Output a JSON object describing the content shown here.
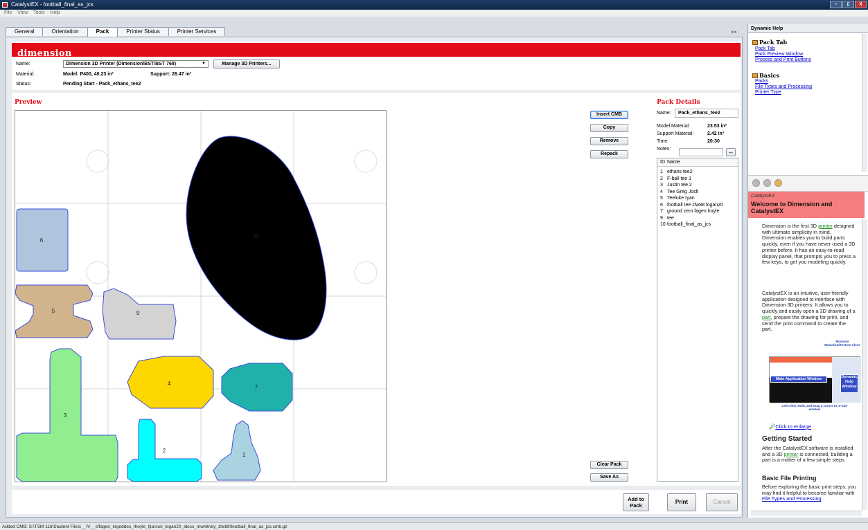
{
  "window": {
    "title": "CatalystEX - football_final_as_jcs",
    "buttons": [
      "–",
      "▯",
      "X"
    ]
  },
  "menu": [
    "File",
    "View",
    "Tools",
    "Help"
  ],
  "tabs": [
    {
      "label": "General",
      "active": false
    },
    {
      "label": "Orientation",
      "active": false
    },
    {
      "label": "Pack",
      "active": true
    },
    {
      "label": "Printer Status",
      "active": false
    },
    {
      "label": "Printer Services",
      "active": false
    }
  ],
  "header": {
    "logo": "dimension",
    "name_label": "Name:",
    "printer_value": "Dimension 3D Printer  (Dimension/BST/BST 768)",
    "manage_button": "Manage 3D Printers...",
    "material_label": "Material:",
    "model_text": "Model: P400, 40.23 in³",
    "support_text": "Support: 26.47 in³",
    "status_label": "Status:",
    "status_value": "Pending Start  -  Pack_ethans_tee2"
  },
  "preview": {
    "title": "Preview",
    "parts": [
      {
        "id": "1",
        "label": "1",
        "color": "#a9d3e0"
      },
      {
        "id": "2",
        "label": "2",
        "color": "#00ffff"
      },
      {
        "id": "3",
        "label": "3",
        "color": "#90ee90"
      },
      {
        "id": "4",
        "label": "4",
        "color": "#ffd700"
      },
      {
        "id": "5",
        "label": "5",
        "color": "#d2b48c"
      },
      {
        "id": "6",
        "label": "6",
        "color": "#b0c4de"
      },
      {
        "id": "7",
        "label": "7",
        "color": "#20b2aa"
      },
      {
        "id": "9",
        "label": "9",
        "color": "#d3d3d3"
      },
      {
        "id": "10",
        "label": "10",
        "color": "#add8e6"
      }
    ]
  },
  "buttons": {
    "insert": "Insert CMB",
    "copy": "Copy",
    "remove": "Remove",
    "repack": "Repack",
    "clear_pack": "Clear Pack",
    "save_as": "Save As",
    "add_to_pack_1": "Add to",
    "add_to_pack_2": "Pack",
    "print": "Print",
    "cancel": "Cancel"
  },
  "pack_details": {
    "title": "Pack Details",
    "name_label": "Name:",
    "name_value": "Pack_ethans_tee2",
    "model_label": "Model Material:",
    "model_value": "23.53 in³",
    "support_label": "Support Material:",
    "support_value": "2.42 in³",
    "time_label": "Time:",
    "time_value": "20:30",
    "notes_label": "Notes:",
    "notes_button": "...",
    "col_id": "ID",
    "col_name": "Name",
    "items": [
      {
        "id": "1",
        "name": "ethans tee2"
      },
      {
        "id": "2",
        "name": "F-ball tee 1"
      },
      {
        "id": "3",
        "name": "Justin tee 2"
      },
      {
        "id": "4",
        "name": "Tee Greg Josh"
      },
      {
        "id": "5",
        "name": "Teeluke ryan"
      },
      {
        "id": "6",
        "name": "football tee zlw88 logan20"
      },
      {
        "id": "7",
        "name": "ground zero fagen hoyle"
      },
      {
        "id": "9",
        "name": "tee"
      },
      {
        "id": "10",
        "name": "football_final_as_jcs"
      }
    ]
  },
  "help": {
    "header": "Dynamic Help",
    "topic1": "Pack Tab",
    "topic1_links": [
      "Pack Tab",
      "Pack Preview Window",
      "Process and Print Buttons"
    ],
    "topic2": "Basics",
    "topic2_links": [
      "Packs",
      "File Types and Processing",
      "Printer Type"
    ],
    "welcome_sub": "CatalystEX",
    "welcome_title": "Welcome to Dimension and CatalystEX",
    "para1_a": "Dimension is the first 3D ",
    "para1_link": "printer",
    "para1_b": " designed with ultimate simplicity in mind. Dimension enables you to build parts quickly, even if you have never used a 3D printer before. It has an easy-to-read display panel, that prompts you to press a few keys, to get you modeling quickly.",
    "para2_a": "CatalystEX is an intuitive, user-friendly application designed to interface with Dimension 3D printers. It allows you to quickly and easily open a 3D drawing of a ",
    "para2_link": "part",
    "para2_b": ", prepare the drawing for print, and send the print command to create the part.",
    "img_minimize": "Minimize Maximize/Restore Close",
    "img_main": "Main Application Window",
    "img_dyn": "Dynamic Help Window",
    "img_caption": "Left-Click, Hold, and Drag a corner to re-size window",
    "enlarge": "Click to enlarge",
    "getting_started": "Getting Started",
    "para3_a": "After the CatalystEX software is installed and a 3D ",
    "para3_link": "printer",
    "para3_b": " is connected, building a part is a matter of a few simple steps.",
    "basic_printing": "Basic File Printing",
    "para4_a": "Before exploring the basic print steps, you may find it helpful to become familiar with ",
    "para4_link": "File Types and Processing",
    "para4_b": "."
  },
  "status_bar": "Added CMB: S:\\TSM 116\\Student Files\\__IV__sffagen_krgeddes_thoyle_tjlarson_logan20_alecs_mwhitney_zlw88\\football_final_as_jcs.cmb.gz"
}
